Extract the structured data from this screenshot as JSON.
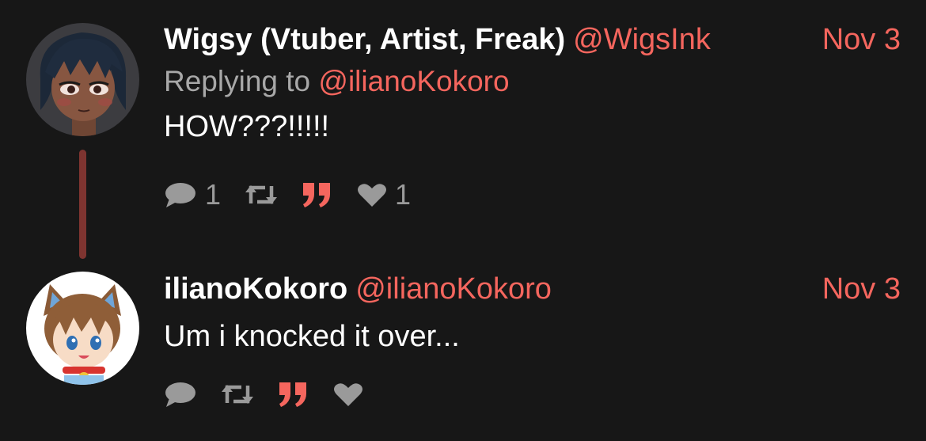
{
  "colors": {
    "background": "#171717",
    "accent": "#f5665e",
    "muted": "#a8a8a8",
    "icon": "#9a9a9a",
    "thread_line": "#7e3430"
  },
  "posts": [
    {
      "display_name": "Wigsy (Vtuber, Artist, Freak)",
      "handle": "@WigsInk",
      "date": "Nov 3",
      "replying_prefix": "Replying to",
      "replying_to": "@ilianoKokoro",
      "text": "HOW???!!!!!",
      "avatar_icon": "wigsy-avatar",
      "actions": {
        "reply_icon": "comment-icon",
        "reply_count": "1",
        "retweet_icon": "retweet-icon",
        "quote_icon": "quote-icon",
        "like_icon": "heart-icon",
        "like_count": "1"
      }
    },
    {
      "display_name": "ilianoKokoro",
      "handle": "@ilianoKokoro",
      "date": "Nov 3",
      "text": "Um i knocked it over...",
      "avatar_icon": "iliano-avatar",
      "actions": {
        "reply_icon": "comment-icon",
        "retweet_icon": "retweet-icon",
        "quote_icon": "quote-icon",
        "like_icon": "heart-icon"
      }
    }
  ]
}
